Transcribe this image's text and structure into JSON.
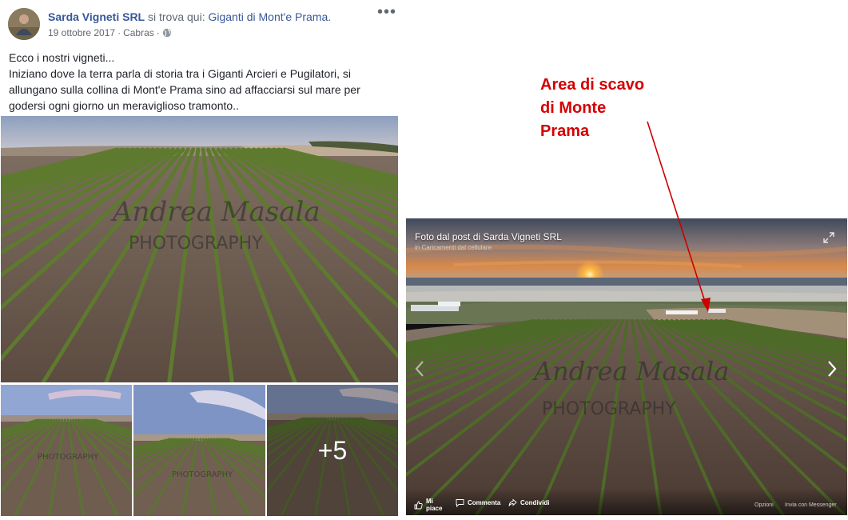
{
  "post": {
    "author": "Sarda Vigneti SRL",
    "location_prefix": "si trova qui:",
    "location": "Giganti di Mont'e Prama.",
    "date": "19 ottobre 2017",
    "separator": "·",
    "place": "Cabras",
    "text_line1": "Ecco i nostri vigneti...",
    "text_body": "Iniziano dove la terra parla di storia tra i Giganti Arcieri e Pugilatori, si allungano sulla collina di Mont'e Prama sino ad affacciarsi sul mare per godersi ogni giorno un meraviglioso tramonto..",
    "more_photos": "+5",
    "watermark_script": "Andrea Masala",
    "watermark_text": "PHOTOGRAPHY",
    "icons": {
      "menu": "more-horizontal-icon",
      "audience": "globe-icon"
    }
  },
  "annotation": {
    "line1": "Area di scavo",
    "line2": "di Monte",
    "line3": "Prama",
    "color": "#d40000"
  },
  "viewer": {
    "title": "Foto dal post di Sarda Vigneti SRL",
    "subtitle": "in Caricamenti dal cellulare",
    "like": "Mi piace",
    "comment": "Commenta",
    "share": "Condividi",
    "options": "Opzioni",
    "messenger": "Invia con Messenger",
    "watermark_text": "PHOTOGRAPHY"
  },
  "colors": {
    "link": "#385898",
    "text": "#1d2129",
    "meta": "#616770"
  }
}
